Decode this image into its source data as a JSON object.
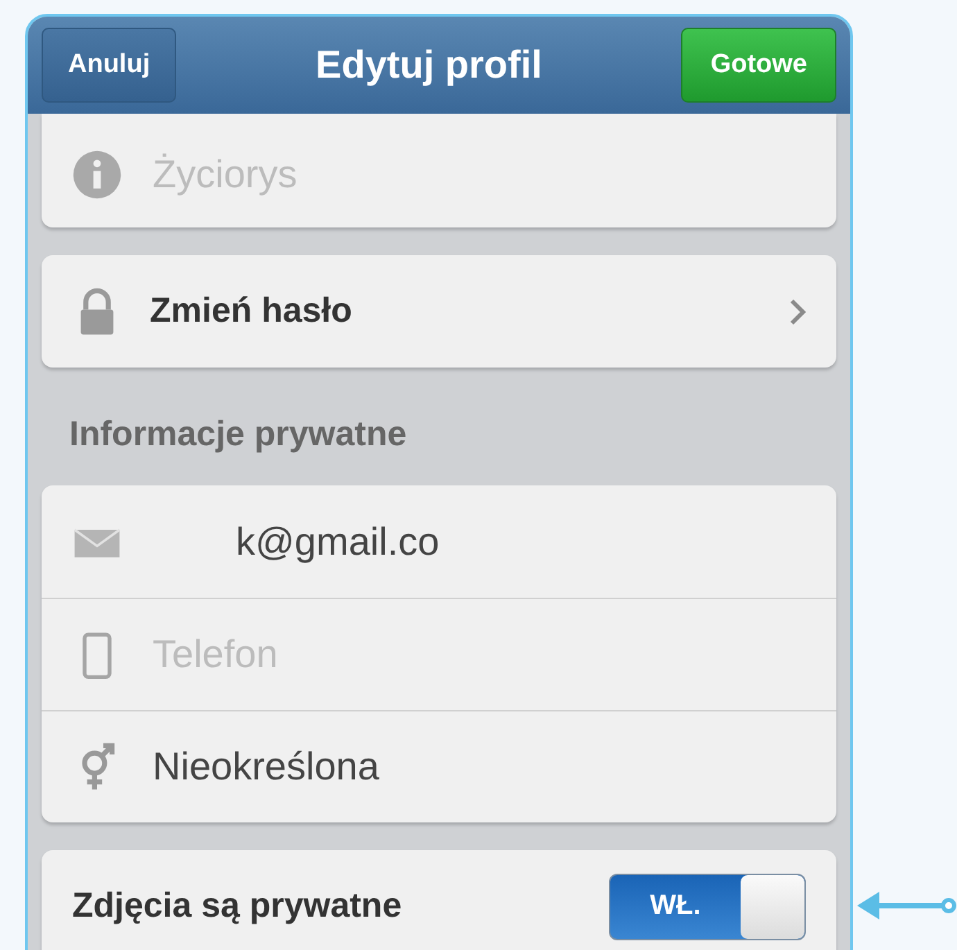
{
  "nav_bar": {
    "cancel_button": "Anuluj",
    "title": "Edytuj profil",
    "done_button": "Gotowe"
  },
  "bio_field": {
    "placeholder": "Życiorys"
  },
  "change_password": {
    "label": "Zmień hasło"
  },
  "private_section": {
    "heading": "Informacje prywatne",
    "fields": [
      {
        "kind": "email",
        "value": "k@gmail.co"
      },
      {
        "kind": "phone",
        "placeholder": "Telefon"
      },
      {
        "kind": "gender",
        "value": "Nieokreślona"
      }
    ]
  },
  "private_photos": {
    "label": "Zdjęcia są prywatne",
    "on": true,
    "toggle_text": "WŁ."
  }
}
